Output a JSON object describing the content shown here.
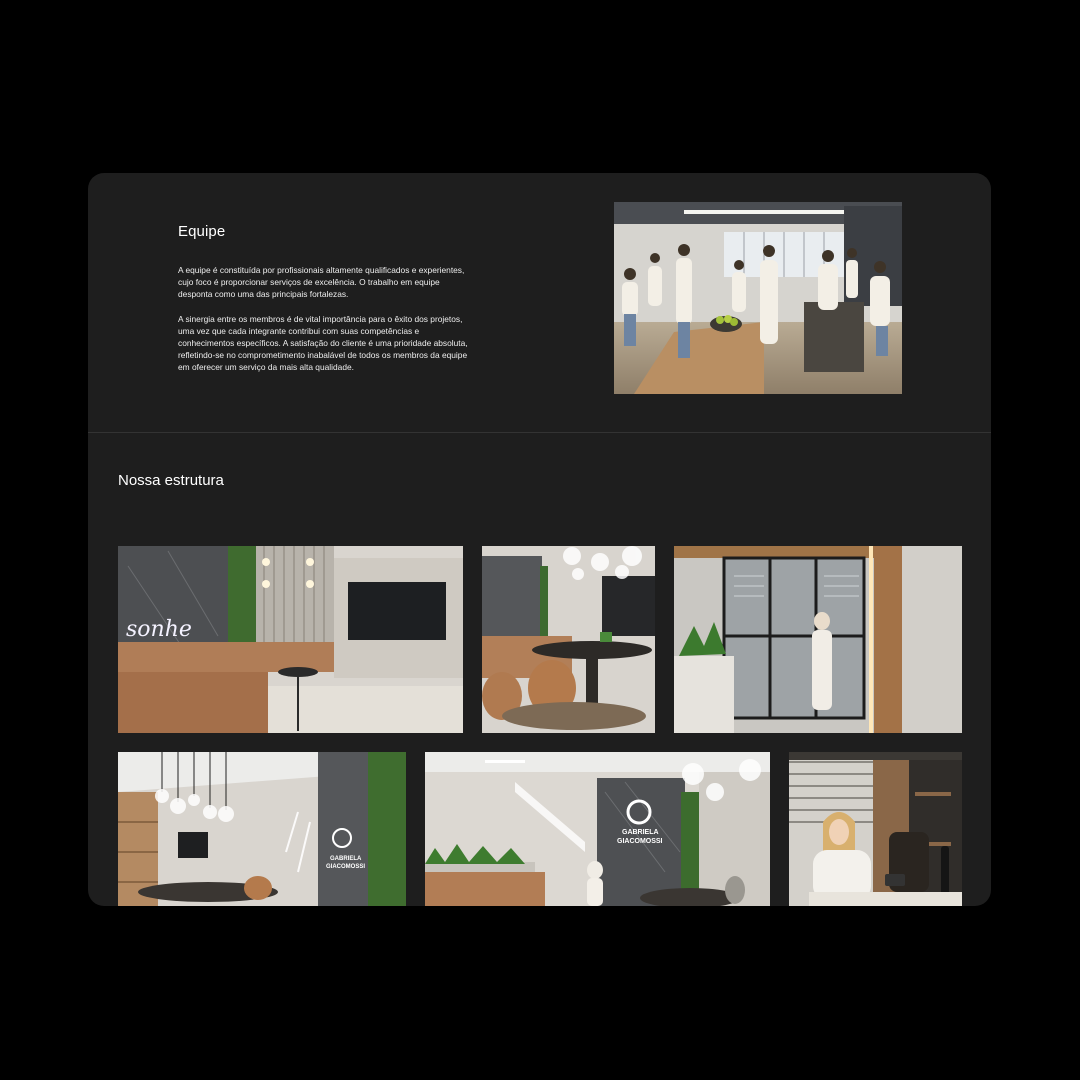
{
  "equipe": {
    "title": "Equipe",
    "paragraph1": "A equipe é constituída por profissionais altamente qualificados e experientes, cujo foco é proporcionar serviços de excelência. O trabalho em equipe desponta como uma das principais fortalezas.",
    "paragraph2": "A sinergia entre os membros é de vital importância para o êxito dos projetos, uma vez que cada integrante contribui com suas competências e conhecimentos específicos. A satisfação do cliente é uma prioridade absoluta, refletindo-se no comprometimento inabalável de todos os membros da equipe em oferecer um serviço da mais alta qualidade.",
    "photo_label": "team-photo"
  },
  "estrutura": {
    "title": "Nossa estrutura",
    "neon_sign": "sonhe",
    "logo_name_line1": "GABRIELA",
    "logo_name_line2": "GIACOMOSSI"
  },
  "colors": {
    "page_background": "#000000",
    "card_background": "#1e1e1e",
    "text_primary": "#ffffff",
    "divider": "#333333"
  }
}
